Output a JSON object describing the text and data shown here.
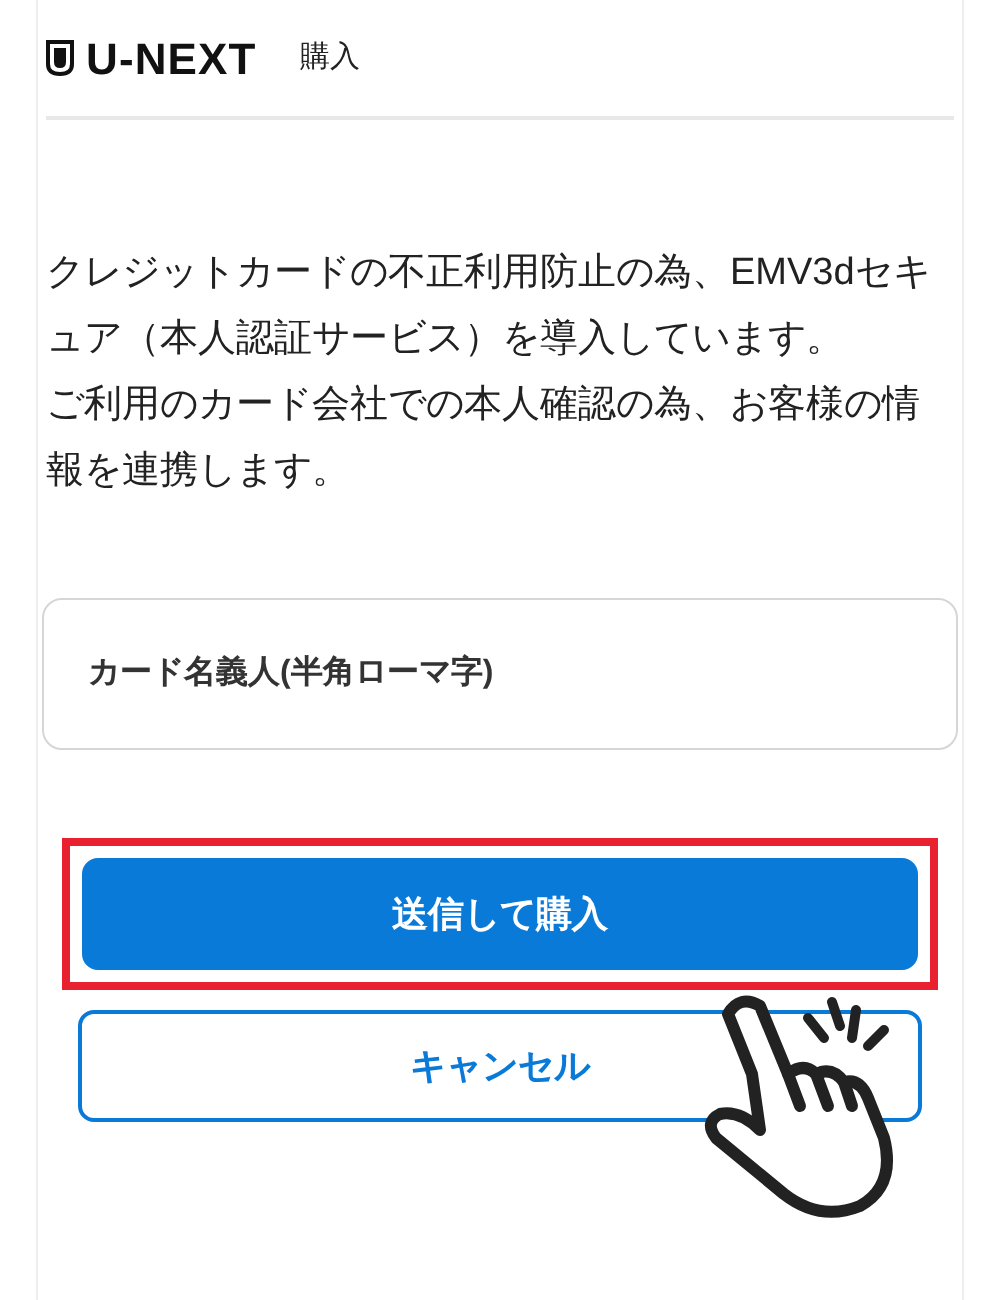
{
  "header": {
    "logo": "U-NEXT",
    "title": "購入"
  },
  "notice": [
    "クレジットカードの不正利用防止の為、EMV3dセキュア（本人認証サービス）を導入しています。",
    "ご利用のカード会社での本人確認の為、お客様の情報を連携します。"
  ],
  "field": {
    "placeholder": "カード名義人(半角ローマ字)"
  },
  "buttons": [
    {
      "label": "送信して購入",
      "kind": "primary",
      "highlighted": true
    },
    {
      "label": "キャンセル",
      "kind": "secondary",
      "highlighted": false
    }
  ]
}
